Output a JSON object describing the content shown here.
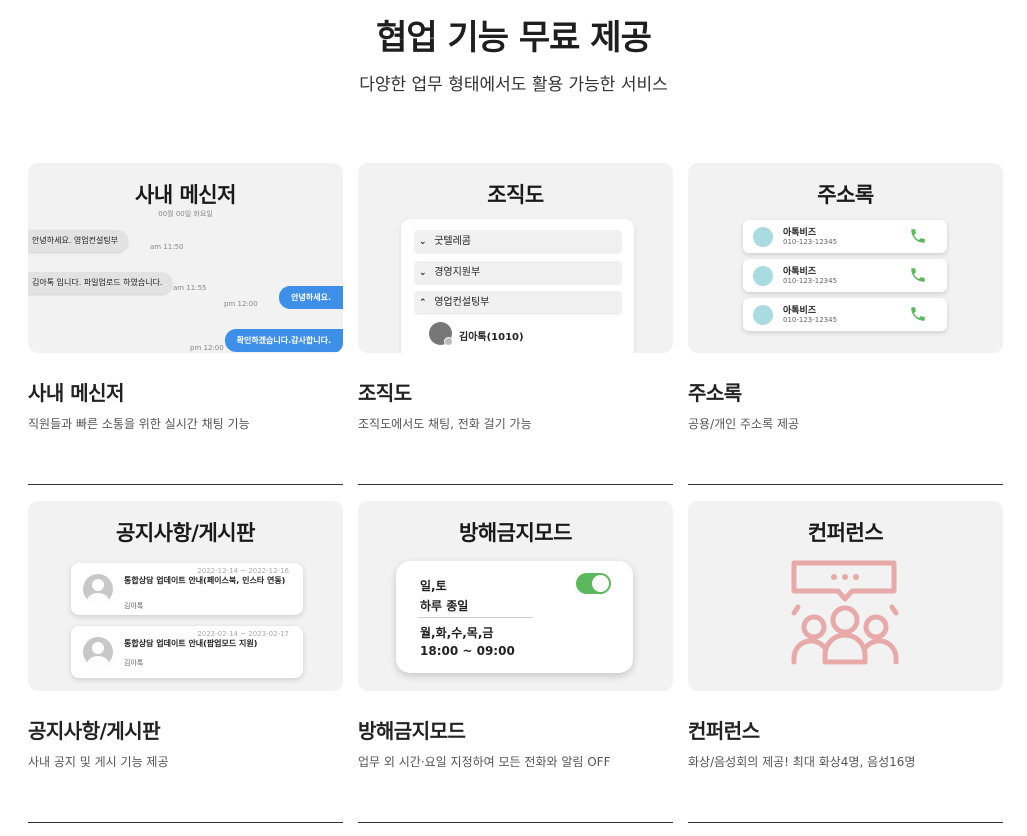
{
  "header": {
    "title": "협업 기능 무료 제공",
    "subtitle": "다양한 업무 형태에서도 활용 가능한 서비스"
  },
  "cards": [
    {
      "image_title": "사내 메신저",
      "heading": "사내 메신저",
      "description": "직원들과 빠른 소통을 위한 실시간 채팅 기능",
      "messenger": {
        "date": "00월 00일 화요일",
        "messages": [
          {
            "text": "안녕하세요. 영업컨설팅부",
            "time": "am 11:50"
          },
          {
            "text": "김아톡 입니다.  파일업로드 하였습니다.",
            "time": "am 11:55"
          },
          {
            "text": "안녕하세요.",
            "time": "pm 12:00"
          },
          {
            "text": "확인하겠습니다.감사합니다.",
            "time": "pm 12:00"
          }
        ]
      }
    },
    {
      "image_title": "조직도",
      "heading": "조직도",
      "description": "조직도에서도 채팅, 전화 걸기 가능",
      "org": {
        "departments": [
          {
            "chevron": "⌄",
            "name": "굿텔레콤"
          },
          {
            "chevron": "⌄",
            "name": "경영지원부"
          },
          {
            "chevron": "⌃",
            "name": "영업컨설팅부"
          }
        ],
        "member": "김아톡(1010)"
      }
    },
    {
      "image_title": "주소록",
      "heading": "주소록",
      "description": "공용/개인 주소록 제공",
      "contacts": [
        {
          "name": "아톡비즈",
          "phone": "010-123-12345"
        },
        {
          "name": "아톡비즈",
          "phone": "010-123-12345"
        },
        {
          "name": "아톡비즈",
          "phone": "010-123-12345"
        }
      ],
      "call_icon_color": "#5cb85c",
      "avatar_color": "#a9dbe0"
    },
    {
      "image_title": "공지사항/게시판",
      "heading": "공지사항/게시판",
      "description": "사내 공지 및 게시 기능 제공",
      "notices": [
        {
          "date": "2022-12-14 ~ 2022-12-16",
          "text": "통합상담 업데이트 안내(페이스북, 인스타 연동)",
          "author": "김아톡"
        },
        {
          "date": "2023-02-14 ~ 2023-02-17",
          "text": "통합상담 업데이트 안내(팝업모드 지원)",
          "author": "김아톡"
        }
      ]
    },
    {
      "image_title": "방해금지모드",
      "heading": "방해금지모드",
      "description": "업무 외 시간·요일 지정하여 모든 전화와 알림 OFF",
      "dnd": {
        "line1": "일,토",
        "line2": "하루 종일",
        "line3": "월,화,수,목,금",
        "line4": "18:00 ~ 09:00",
        "toggle_on": true,
        "toggle_color": "#5cb85c"
      }
    },
    {
      "image_title": "컨퍼런스",
      "heading": "컨퍼런스",
      "description": "화상/음성회의 제공! 최대 화상4명, 음성16명",
      "icon_name": "conference-icon",
      "icon_color": "#e8a9a9"
    }
  ]
}
